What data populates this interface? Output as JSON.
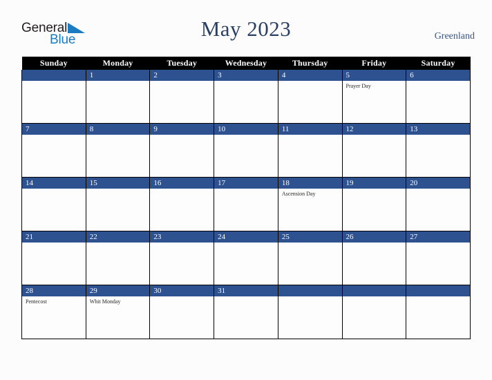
{
  "brand": {
    "name_part1": "General",
    "name_part2": "Blue",
    "triangle_icon": "triangle-icon",
    "color_dark": "#231f20",
    "color_blue": "#1b7bc1"
  },
  "header": {
    "title": "May 2023",
    "region": "Greenland",
    "title_color": "#2b3f62",
    "region_color": "#3c5480"
  },
  "calendar": {
    "month": "May",
    "year": "2023",
    "weekday_headers": [
      "Sunday",
      "Monday",
      "Tuesday",
      "Wednesday",
      "Thursday",
      "Friday",
      "Saturday"
    ],
    "header_bg": "#000000",
    "header_text_color": "#ffffff",
    "daybar_bg": "#2e5190",
    "daybar_text_color": "#ffffff",
    "cell_bg": "#fdfdfd",
    "border_color": "#000000",
    "weeks": [
      [
        {
          "date": "",
          "events": []
        },
        {
          "date": "1",
          "events": []
        },
        {
          "date": "2",
          "events": []
        },
        {
          "date": "3",
          "events": []
        },
        {
          "date": "4",
          "events": []
        },
        {
          "date": "5",
          "events": [
            "Prayer Day"
          ]
        },
        {
          "date": "6",
          "events": []
        }
      ],
      [
        {
          "date": "7",
          "events": []
        },
        {
          "date": "8",
          "events": []
        },
        {
          "date": "9",
          "events": []
        },
        {
          "date": "10",
          "events": []
        },
        {
          "date": "11",
          "events": []
        },
        {
          "date": "12",
          "events": []
        },
        {
          "date": "13",
          "events": []
        }
      ],
      [
        {
          "date": "14",
          "events": []
        },
        {
          "date": "15",
          "events": []
        },
        {
          "date": "16",
          "events": []
        },
        {
          "date": "17",
          "events": []
        },
        {
          "date": "18",
          "events": [
            "Ascension Day"
          ]
        },
        {
          "date": "19",
          "events": []
        },
        {
          "date": "20",
          "events": []
        }
      ],
      [
        {
          "date": "21",
          "events": []
        },
        {
          "date": "22",
          "events": []
        },
        {
          "date": "23",
          "events": []
        },
        {
          "date": "24",
          "events": []
        },
        {
          "date": "25",
          "events": []
        },
        {
          "date": "26",
          "events": []
        },
        {
          "date": "27",
          "events": []
        }
      ],
      [
        {
          "date": "28",
          "events": [
            "Pentecost"
          ]
        },
        {
          "date": "29",
          "events": [
            "Whit Monday"
          ]
        },
        {
          "date": "30",
          "events": []
        },
        {
          "date": "31",
          "events": []
        },
        {
          "date": "",
          "events": []
        },
        {
          "date": "",
          "events": []
        },
        {
          "date": "",
          "events": []
        }
      ]
    ]
  }
}
